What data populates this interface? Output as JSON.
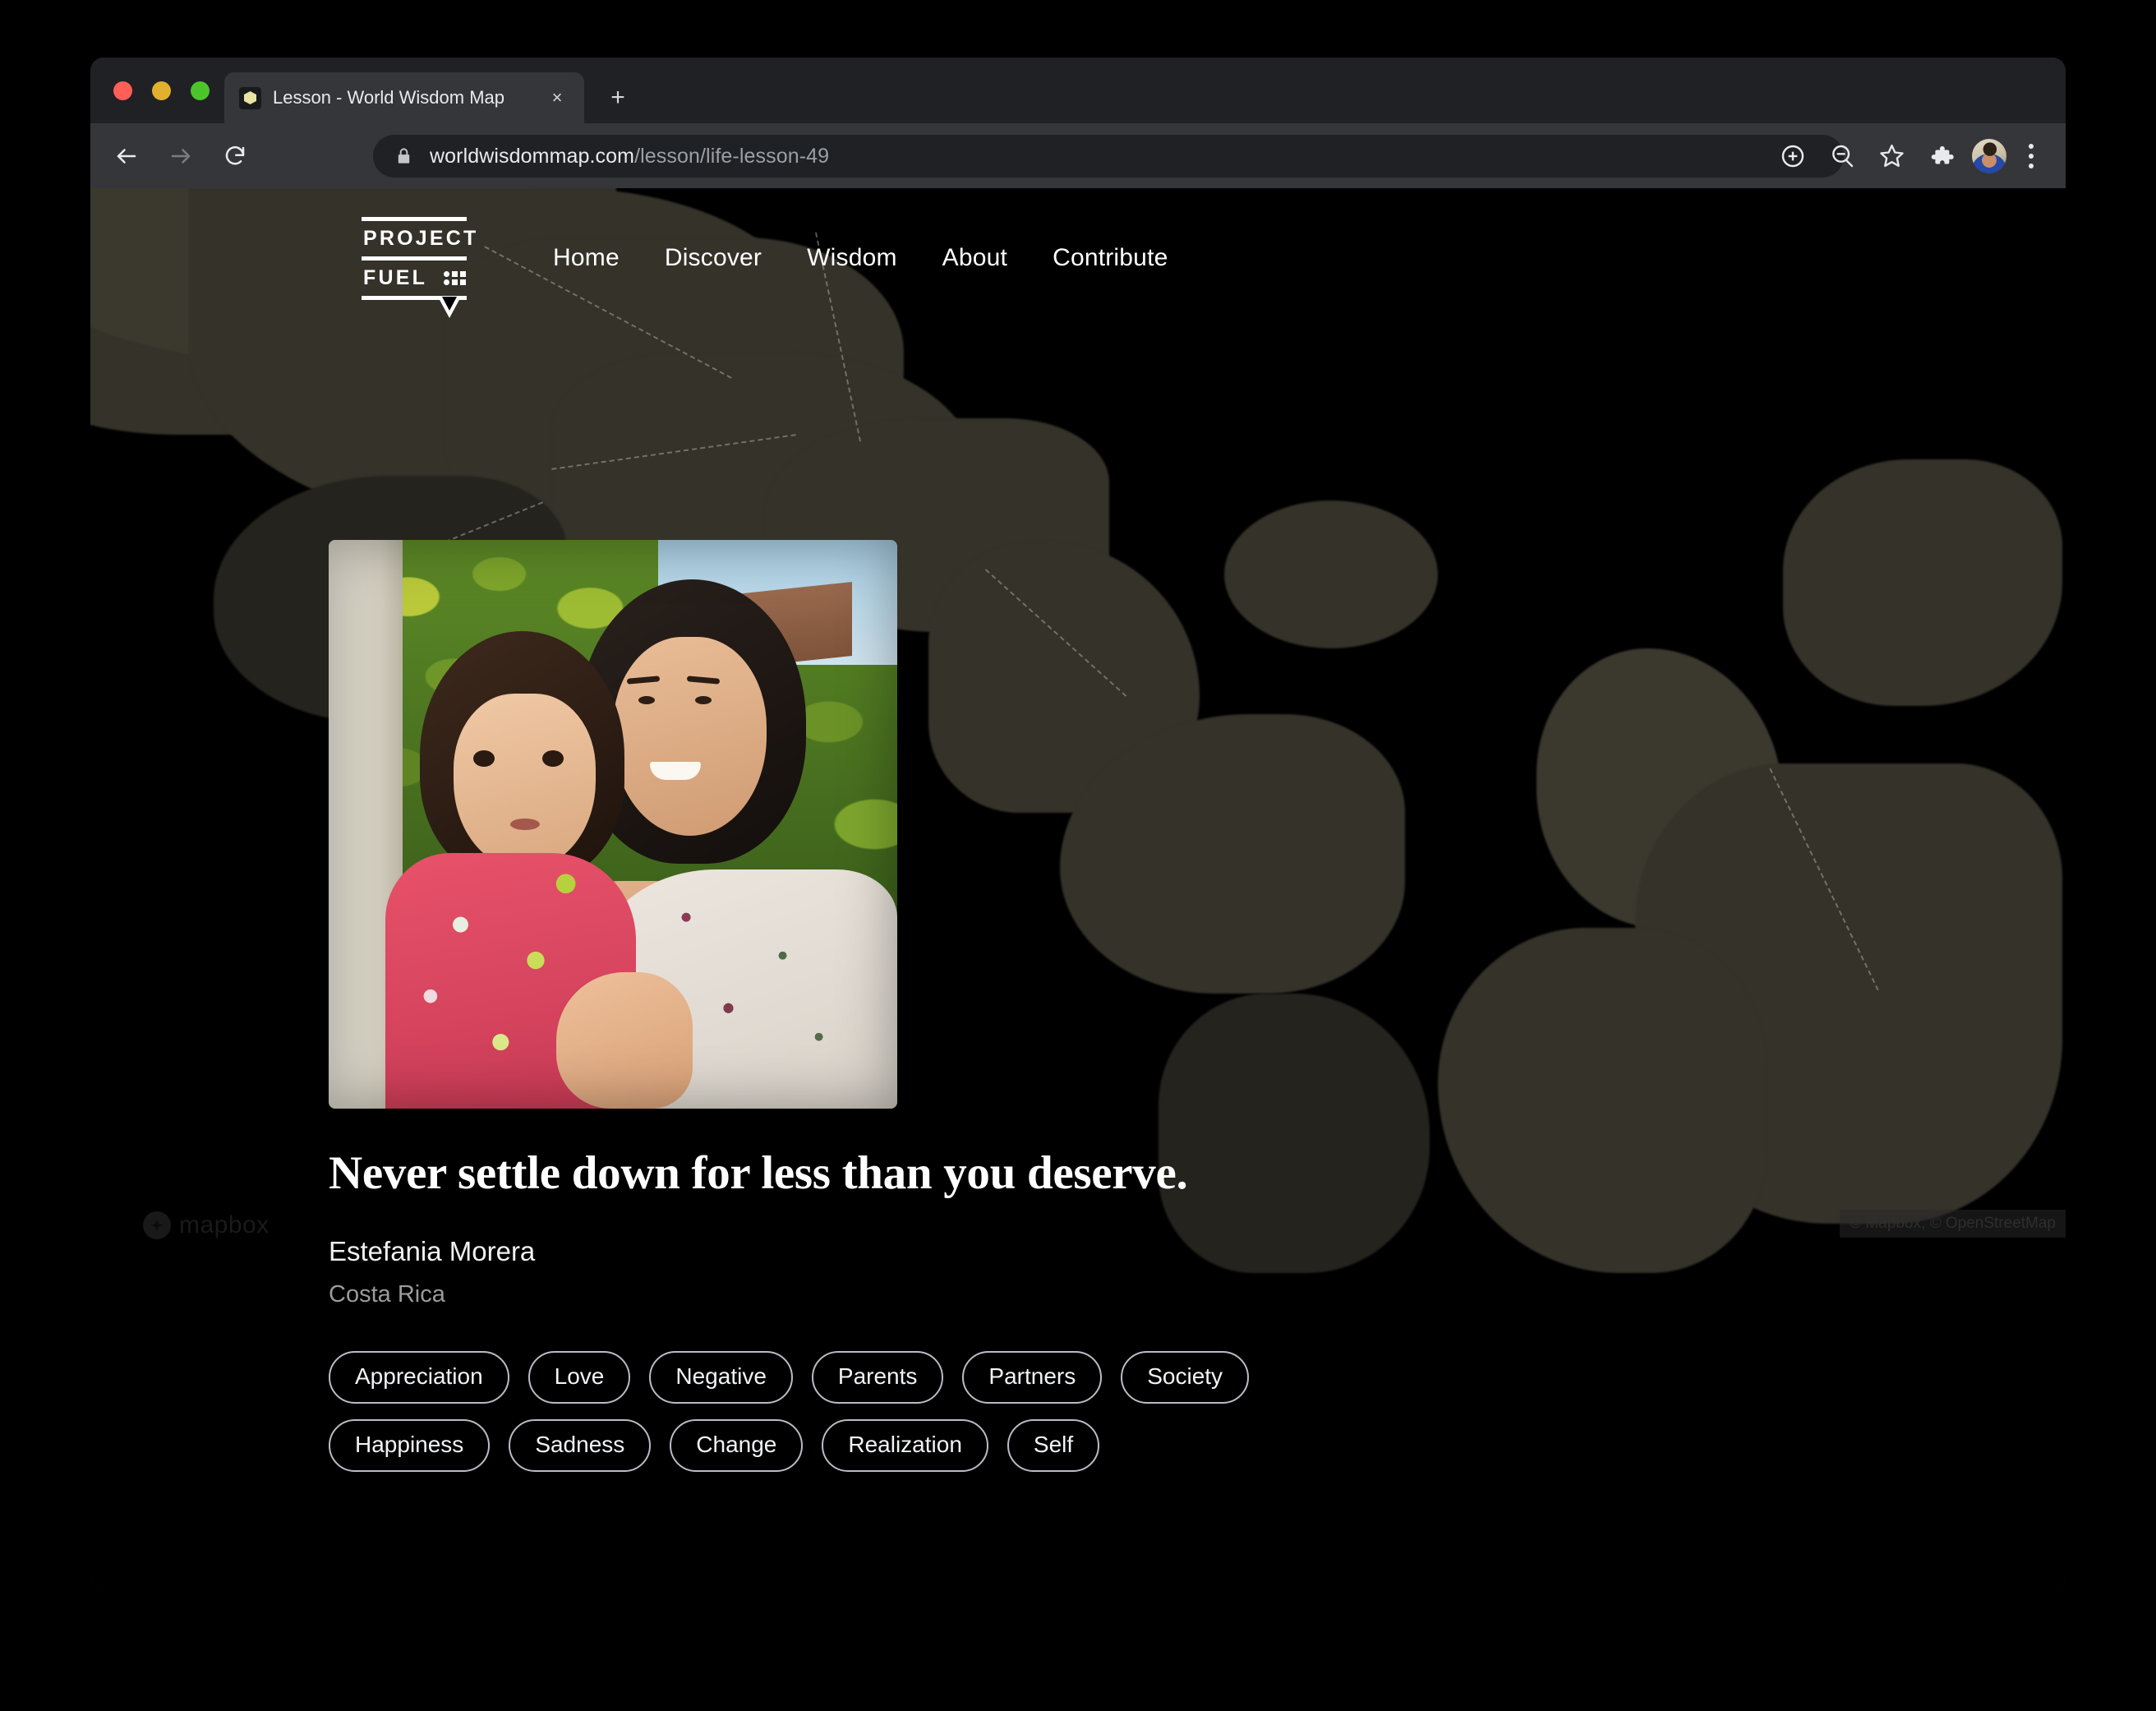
{
  "browser": {
    "tab": {
      "title": "Lesson - World Wisdom Map",
      "favicon": "hexagon-icon",
      "close_label": "×"
    },
    "new_tab_label": "+",
    "omnibox": {
      "lock_icon": "lock-icon",
      "host": "worldwisdommap.com",
      "path": "/lesson/life-lesson-49"
    },
    "toolbar_icons": [
      "back-arrow-icon",
      "forward-arrow-icon",
      "reload-icon",
      "zoom-in-icon",
      "search-zoom-out-icon",
      "bookmark-star-icon",
      "extensions-puzzle-icon",
      "profile-avatar",
      "more-menu-icon"
    ],
    "window_colors": {
      "tabstrip": "#202124",
      "toolbar": "#35363a",
      "active_tab": "#35363a"
    },
    "traffic_lights": [
      "#ff5f57",
      "#e0b02e",
      "#4cc52c"
    ]
  },
  "site": {
    "logo": {
      "line1": "PROJECT",
      "line2": "FUEL",
      "mark": "dot-grid-icon"
    },
    "nav": [
      {
        "label": "Home"
      },
      {
        "label": "Discover"
      },
      {
        "label": "Wisdom"
      },
      {
        "label": "About"
      },
      {
        "label": "Contribute"
      }
    ]
  },
  "lesson": {
    "photo_alt": "Woman holding a toddler outdoors in front of green foliage",
    "quote": "Never settle down for less than you deserve.",
    "author": "Estefania Morera",
    "country": "Costa Rica",
    "tags": [
      "Appreciation",
      "Love",
      "Negative",
      "Parents",
      "Partners",
      "Society",
      "Happiness",
      "Sadness",
      "Change",
      "Realization",
      "Self"
    ]
  },
  "map": {
    "logo_text": "mapbox",
    "attribution": "© Mapbox, © OpenStreetMap",
    "colors": {
      "ocean": "#000000",
      "land": "#343229"
    }
  }
}
